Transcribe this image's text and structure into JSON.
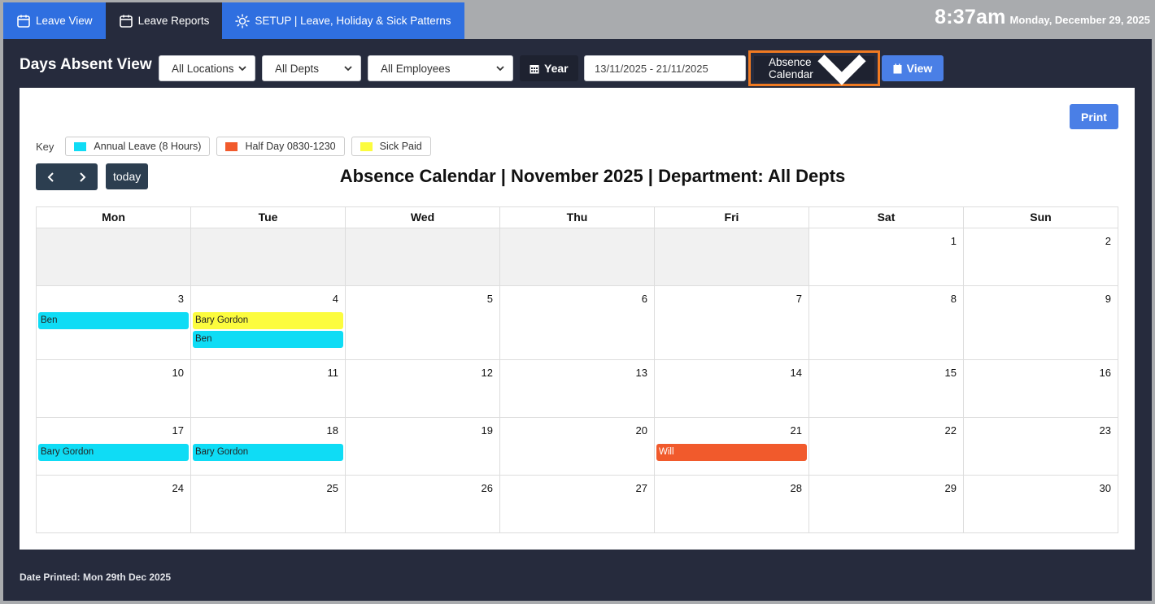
{
  "tabs": [
    {
      "label": "Leave View",
      "icon": "calendar-icon",
      "active": false
    },
    {
      "label": "Leave Reports",
      "icon": "calendar-icon",
      "active": true
    },
    {
      "label": "SETUP | Leave, Holiday & Sick Patterns",
      "icon": "sun-icon",
      "active": false
    }
  ],
  "clock": {
    "time": "8:37am",
    "date": "Monday, December 29, 2025"
  },
  "toolbar": {
    "title": "Days Absent View",
    "location": "All Locations",
    "dept": "All Depts",
    "employee": "All Employees",
    "year_label": "Year",
    "date_range": "13/11/2025 - 21/11/2025",
    "view_type": "Absence Calendar",
    "view_label": "View"
  },
  "card": {
    "print_label": "Print",
    "key_label": "Key",
    "key_items": [
      {
        "label": "Annual Leave (8 Hours)",
        "color": "#0fdcf5"
      },
      {
        "label": "Half Day 0830-1230",
        "color": "#f15a2c"
      },
      {
        "label": "Sick Paid",
        "color": "#fcfc3e"
      }
    ],
    "today_label": "today",
    "title": "Absence Calendar | November 2025 | Department: All Depts"
  },
  "calendar": {
    "weekdays": [
      "Mon",
      "Tue",
      "Wed",
      "Thu",
      "Fri",
      "Sat",
      "Sun"
    ],
    "weeks": [
      [
        {
          "day": ""
        },
        {
          "day": ""
        },
        {
          "day": ""
        },
        {
          "day": ""
        },
        {
          "day": ""
        },
        {
          "day": "1"
        },
        {
          "day": "2"
        }
      ],
      [
        {
          "day": "3",
          "events": [
            {
              "name": "Ben",
              "type": 0
            }
          ]
        },
        {
          "day": "4",
          "events": [
            {
              "name": "Bary Gordon",
              "type": 2
            },
            {
              "name": "Ben",
              "type": 0
            }
          ]
        },
        {
          "day": "5"
        },
        {
          "day": "6"
        },
        {
          "day": "7"
        },
        {
          "day": "8"
        },
        {
          "day": "9"
        }
      ],
      [
        {
          "day": "10"
        },
        {
          "day": "11"
        },
        {
          "day": "12"
        },
        {
          "day": "13"
        },
        {
          "day": "14"
        },
        {
          "day": "15"
        },
        {
          "day": "16"
        }
      ],
      [
        {
          "day": "17",
          "events": [
            {
              "name": "Bary Gordon",
              "type": 0
            }
          ]
        },
        {
          "day": "18",
          "events": [
            {
              "name": "Bary Gordon",
              "type": 0
            }
          ]
        },
        {
          "day": "19"
        },
        {
          "day": "20"
        },
        {
          "day": "21",
          "events": [
            {
              "name": "Will",
              "type": 1
            }
          ]
        },
        {
          "day": "22"
        },
        {
          "day": "23"
        }
      ],
      [
        {
          "day": "24"
        },
        {
          "day": "25"
        },
        {
          "day": "26"
        },
        {
          "day": "27"
        },
        {
          "day": "28"
        },
        {
          "day": "29"
        },
        {
          "day": "30"
        }
      ]
    ],
    "event_colors": [
      "#0fdcf5",
      "#f15a2c",
      "#fcfc3e"
    ],
    "event_text_colors": [
      "#222222",
      "#ffffff",
      "#222222"
    ]
  },
  "footer": {
    "date_printed": "Date Printed: Mon 29th Dec 2025"
  }
}
